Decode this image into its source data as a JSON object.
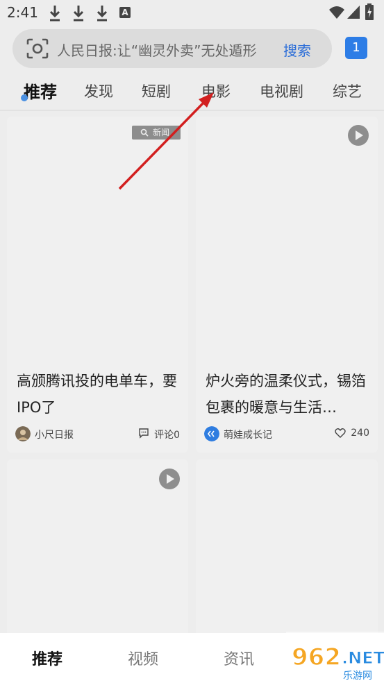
{
  "status_bar": {
    "time": "2:41",
    "icons": [
      "download-icon",
      "download-icon",
      "download-icon",
      "a-icon",
      "wifi-icon",
      "signal-icon",
      "battery-charging-icon"
    ]
  },
  "search": {
    "hint": "人民日报:让“幽灵外卖”无处遁形",
    "button_label": "搜索",
    "badge_count": "1"
  },
  "tabs": [
    {
      "label": "推荐",
      "active": true
    },
    {
      "label": "发现"
    },
    {
      "label": "短剧"
    },
    {
      "label": "电影"
    },
    {
      "label": "电视剧"
    },
    {
      "label": "综艺"
    }
  ],
  "feed": [
    {
      "tag": "新闻",
      "title": "高颁腾讯投的电单车，要IPO了",
      "author": "小尺日报",
      "meta_label": "评论0",
      "meta_icon": "comment-icon"
    },
    {
      "title": "炉火旁的温柔仪式，锡箔包裹的暖意与生活…",
      "author": "萌娃成长记",
      "meta_label": "240",
      "meta_icon": "heart-icon",
      "has_play": true
    },
    {
      "has_play": true
    },
    {}
  ],
  "bottom_nav": [
    {
      "label": "推荐",
      "active": true
    },
    {
      "label": "视频"
    },
    {
      "label": "资讯"
    }
  ],
  "colors": {
    "accent": "#2e6fd8",
    "background": "#ededed",
    "card": "#f0f0f0",
    "arrow": "#d21f1f"
  }
}
